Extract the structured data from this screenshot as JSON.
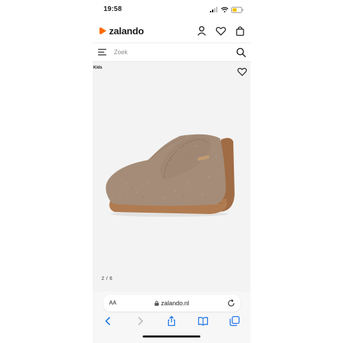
{
  "status_bar": {
    "time": "19:58"
  },
  "header": {
    "brand": "zalando"
  },
  "search": {
    "placeholder": "Zoek"
  },
  "product": {
    "category_tag": "Kids",
    "image_counter": "2 / 6"
  },
  "browser": {
    "text_size_label": "AA",
    "url": "zalando.nl"
  },
  "colors": {
    "brand_orange": "#ff6900",
    "safari_blue": "#1a73e8"
  }
}
